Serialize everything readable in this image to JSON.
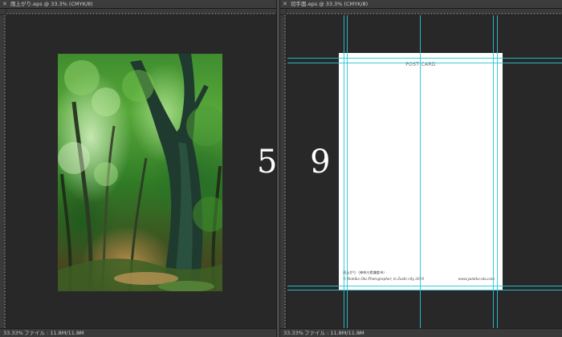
{
  "left_window": {
    "tab_close": "✕",
    "tab_title": "雨上がり.eps @ 33.3% (CMYK/8)",
    "status_zoom": "33.33%",
    "status_info": "ファイル : 11.8M/11.8M",
    "status_arrow": "›"
  },
  "right_window": {
    "tab_close": "✕",
    "tab_title": "切手面.eps @ 33.3% (CMYK/8)",
    "status_zoom": "33.33%",
    "status_info": "ファイル : 11.8M/11.8M",
    "status_arrow": "›"
  },
  "postcard": {
    "title": "POST CARD",
    "caption": "雨上がり（神奈川県鎌倉市）",
    "copyright": "© Yumiko Ota Photographer, in Zushi city 2018",
    "url": "www.yumiko-ota.com"
  },
  "overlay_number": "5 9",
  "colors": {
    "canvas": "#282828",
    "guide": "#27c4d6",
    "panel": "#3a3a3a"
  }
}
